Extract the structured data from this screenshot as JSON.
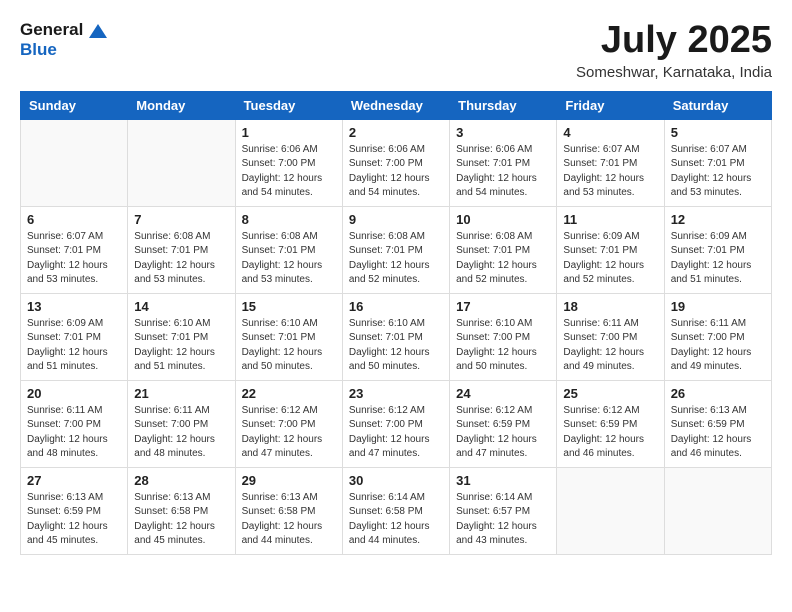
{
  "header": {
    "logo_general": "General",
    "logo_blue": "Blue",
    "month_year": "July 2025",
    "location": "Someshwar, Karnataka, India"
  },
  "days_of_week": [
    "Sunday",
    "Monday",
    "Tuesday",
    "Wednesday",
    "Thursday",
    "Friday",
    "Saturday"
  ],
  "weeks": [
    [
      {
        "day": "",
        "info": ""
      },
      {
        "day": "",
        "info": ""
      },
      {
        "day": "1",
        "info": "Sunrise: 6:06 AM\nSunset: 7:00 PM\nDaylight: 12 hours and 54 minutes."
      },
      {
        "day": "2",
        "info": "Sunrise: 6:06 AM\nSunset: 7:00 PM\nDaylight: 12 hours and 54 minutes."
      },
      {
        "day": "3",
        "info": "Sunrise: 6:06 AM\nSunset: 7:01 PM\nDaylight: 12 hours and 54 minutes."
      },
      {
        "day": "4",
        "info": "Sunrise: 6:07 AM\nSunset: 7:01 PM\nDaylight: 12 hours and 53 minutes."
      },
      {
        "day": "5",
        "info": "Sunrise: 6:07 AM\nSunset: 7:01 PM\nDaylight: 12 hours and 53 minutes."
      }
    ],
    [
      {
        "day": "6",
        "info": "Sunrise: 6:07 AM\nSunset: 7:01 PM\nDaylight: 12 hours and 53 minutes."
      },
      {
        "day": "7",
        "info": "Sunrise: 6:08 AM\nSunset: 7:01 PM\nDaylight: 12 hours and 53 minutes."
      },
      {
        "day": "8",
        "info": "Sunrise: 6:08 AM\nSunset: 7:01 PM\nDaylight: 12 hours and 53 minutes."
      },
      {
        "day": "9",
        "info": "Sunrise: 6:08 AM\nSunset: 7:01 PM\nDaylight: 12 hours and 52 minutes."
      },
      {
        "day": "10",
        "info": "Sunrise: 6:08 AM\nSunset: 7:01 PM\nDaylight: 12 hours and 52 minutes."
      },
      {
        "day": "11",
        "info": "Sunrise: 6:09 AM\nSunset: 7:01 PM\nDaylight: 12 hours and 52 minutes."
      },
      {
        "day": "12",
        "info": "Sunrise: 6:09 AM\nSunset: 7:01 PM\nDaylight: 12 hours and 51 minutes."
      }
    ],
    [
      {
        "day": "13",
        "info": "Sunrise: 6:09 AM\nSunset: 7:01 PM\nDaylight: 12 hours and 51 minutes."
      },
      {
        "day": "14",
        "info": "Sunrise: 6:10 AM\nSunset: 7:01 PM\nDaylight: 12 hours and 51 minutes."
      },
      {
        "day": "15",
        "info": "Sunrise: 6:10 AM\nSunset: 7:01 PM\nDaylight: 12 hours and 50 minutes."
      },
      {
        "day": "16",
        "info": "Sunrise: 6:10 AM\nSunset: 7:01 PM\nDaylight: 12 hours and 50 minutes."
      },
      {
        "day": "17",
        "info": "Sunrise: 6:10 AM\nSunset: 7:00 PM\nDaylight: 12 hours and 50 minutes."
      },
      {
        "day": "18",
        "info": "Sunrise: 6:11 AM\nSunset: 7:00 PM\nDaylight: 12 hours and 49 minutes."
      },
      {
        "day": "19",
        "info": "Sunrise: 6:11 AM\nSunset: 7:00 PM\nDaylight: 12 hours and 49 minutes."
      }
    ],
    [
      {
        "day": "20",
        "info": "Sunrise: 6:11 AM\nSunset: 7:00 PM\nDaylight: 12 hours and 48 minutes."
      },
      {
        "day": "21",
        "info": "Sunrise: 6:11 AM\nSunset: 7:00 PM\nDaylight: 12 hours and 48 minutes."
      },
      {
        "day": "22",
        "info": "Sunrise: 6:12 AM\nSunset: 7:00 PM\nDaylight: 12 hours and 47 minutes."
      },
      {
        "day": "23",
        "info": "Sunrise: 6:12 AM\nSunset: 7:00 PM\nDaylight: 12 hours and 47 minutes."
      },
      {
        "day": "24",
        "info": "Sunrise: 6:12 AM\nSunset: 6:59 PM\nDaylight: 12 hours and 47 minutes."
      },
      {
        "day": "25",
        "info": "Sunrise: 6:12 AM\nSunset: 6:59 PM\nDaylight: 12 hours and 46 minutes."
      },
      {
        "day": "26",
        "info": "Sunrise: 6:13 AM\nSunset: 6:59 PM\nDaylight: 12 hours and 46 minutes."
      }
    ],
    [
      {
        "day": "27",
        "info": "Sunrise: 6:13 AM\nSunset: 6:59 PM\nDaylight: 12 hours and 45 minutes."
      },
      {
        "day": "28",
        "info": "Sunrise: 6:13 AM\nSunset: 6:58 PM\nDaylight: 12 hours and 45 minutes."
      },
      {
        "day": "29",
        "info": "Sunrise: 6:13 AM\nSunset: 6:58 PM\nDaylight: 12 hours and 44 minutes."
      },
      {
        "day": "30",
        "info": "Sunrise: 6:14 AM\nSunset: 6:58 PM\nDaylight: 12 hours and 44 minutes."
      },
      {
        "day": "31",
        "info": "Sunrise: 6:14 AM\nSunset: 6:57 PM\nDaylight: 12 hours and 43 minutes."
      },
      {
        "day": "",
        "info": ""
      },
      {
        "day": "",
        "info": ""
      }
    ]
  ]
}
